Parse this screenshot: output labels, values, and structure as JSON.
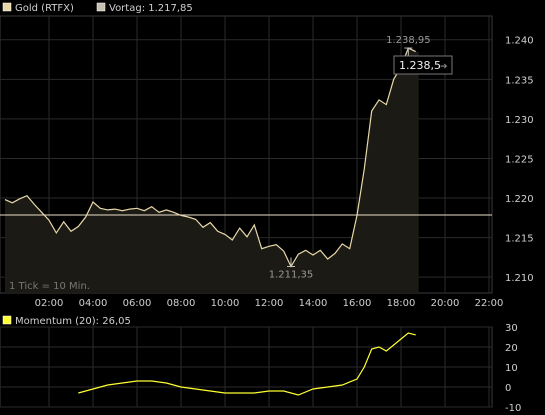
{
  "legend": {
    "series1_label": "Gold (RTFX)",
    "series1_color": "#e8d8a8",
    "series2_label": "Vortag: 1.217,85",
    "series2_color": "#c8c0b0",
    "momentum_label": "Momentum (20): 26,05",
    "momentum_color": "#ffff33"
  },
  "tick_note": "1 Tick = 10 Min.",
  "annotations": {
    "high_label": "1.238,95",
    "low_label": "1.211,35",
    "last_label": "1.238,5",
    "last_arrow": "➔"
  },
  "chart_data": [
    {
      "type": "line",
      "x_axis": {
        "ticks": [
          "02:00",
          "04:00",
          "06:00",
          "08:00",
          "10:00",
          "12:00",
          "14:00",
          "16:00",
          "18:00",
          "20:00",
          "22:00"
        ],
        "range": [
          "00:00",
          "24:00"
        ]
      },
      "ylim": [
        1208,
        1243
      ],
      "y_ticks": [
        1210,
        1215,
        1220,
        1225,
        1230,
        1235,
        1240
      ],
      "y_tick_labels": [
        "1.210",
        "1.215",
        "1.220",
        "1.225",
        "1.230",
        "1.235",
        "1.240"
      ],
      "reference_line": {
        "label": "Vortag",
        "value": 1217.85
      },
      "grid": true,
      "series": [
        {
          "name": "Gold (RTFX)",
          "x": [
            "00:00",
            "00:20",
            "00:40",
            "01:00",
            "01:20",
            "01:40",
            "02:00",
            "02:20",
            "02:40",
            "03:00",
            "03:20",
            "03:40",
            "04:00",
            "04:20",
            "04:40",
            "05:00",
            "05:20",
            "05:40",
            "06:00",
            "06:20",
            "06:40",
            "07:00",
            "07:20",
            "07:40",
            "08:00",
            "08:20",
            "08:40",
            "09:00",
            "09:20",
            "09:40",
            "10:00",
            "10:20",
            "10:40",
            "11:00",
            "11:20",
            "11:40",
            "12:00",
            "12:20",
            "12:40",
            "13:00",
            "13:20",
            "13:40",
            "14:00",
            "14:20",
            "14:40",
            "15:00",
            "15:20",
            "15:40",
            "16:00",
            "16:20",
            "16:40",
            "17:00",
            "17:20",
            "17:40",
            "18:00",
            "18:20",
            "18:40"
          ],
          "values": [
            1219.8,
            1219.4,
            1219.9,
            1220.3,
            1219.2,
            1218.2,
            1217.2,
            1215.6,
            1217.0,
            1215.8,
            1216.4,
            1217.6,
            1219.5,
            1218.7,
            1218.5,
            1218.6,
            1218.4,
            1218.6,
            1218.7,
            1218.4,
            1218.9,
            1218.2,
            1218.5,
            1218.2,
            1217.8,
            1217.6,
            1217.3,
            1216.3,
            1216.9,
            1215.8,
            1215.4,
            1214.7,
            1216.2,
            1215.1,
            1216.6,
            1213.6,
            1213.9,
            1214.1,
            1213.3,
            1211.35,
            1212.9,
            1213.4,
            1212.8,
            1213.4,
            1212.3,
            1213.0,
            1214.2,
            1213.6,
            1217.8,
            1223.7,
            1231.0,
            1232.4,
            1231.8,
            1235.0,
            1236.6,
            1238.95,
            1238.5
          ]
        }
      ],
      "high": {
        "x": "18:20",
        "value": 1238.95
      },
      "low": {
        "x": "13:00",
        "value": 1211.35
      },
      "last": 1238.5
    },
    {
      "type": "line",
      "title": "Momentum (20)",
      "last_value": 26.05,
      "ylim": [
        -10,
        30
      ],
      "y_ticks": [
        -10,
        0,
        10,
        20,
        30
      ],
      "y_tick_labels": [
        "-10",
        "0",
        "10",
        "20",
        "30"
      ],
      "grid": true,
      "series": [
        {
          "name": "Momentum (20)",
          "x": [
            "03:20",
            "04:00",
            "04:40",
            "05:20",
            "06:00",
            "06:40",
            "07:20",
            "08:00",
            "08:40",
            "09:20",
            "10:00",
            "10:40",
            "11:20",
            "12:00",
            "12:40",
            "13:20",
            "14:00",
            "14:40",
            "15:20",
            "16:00",
            "16:20",
            "16:40",
            "17:00",
            "17:20",
            "17:40",
            "18:00",
            "18:20",
            "18:40"
          ],
          "values": [
            -3,
            -1,
            1,
            2,
            3,
            3,
            2,
            0,
            -1,
            -2,
            -3,
            -3,
            -3,
            -2,
            -2,
            -4,
            -1,
            0,
            1,
            4,
            10,
            19,
            20,
            18,
            21,
            24,
            27,
            26.05
          ]
        }
      ]
    }
  ]
}
